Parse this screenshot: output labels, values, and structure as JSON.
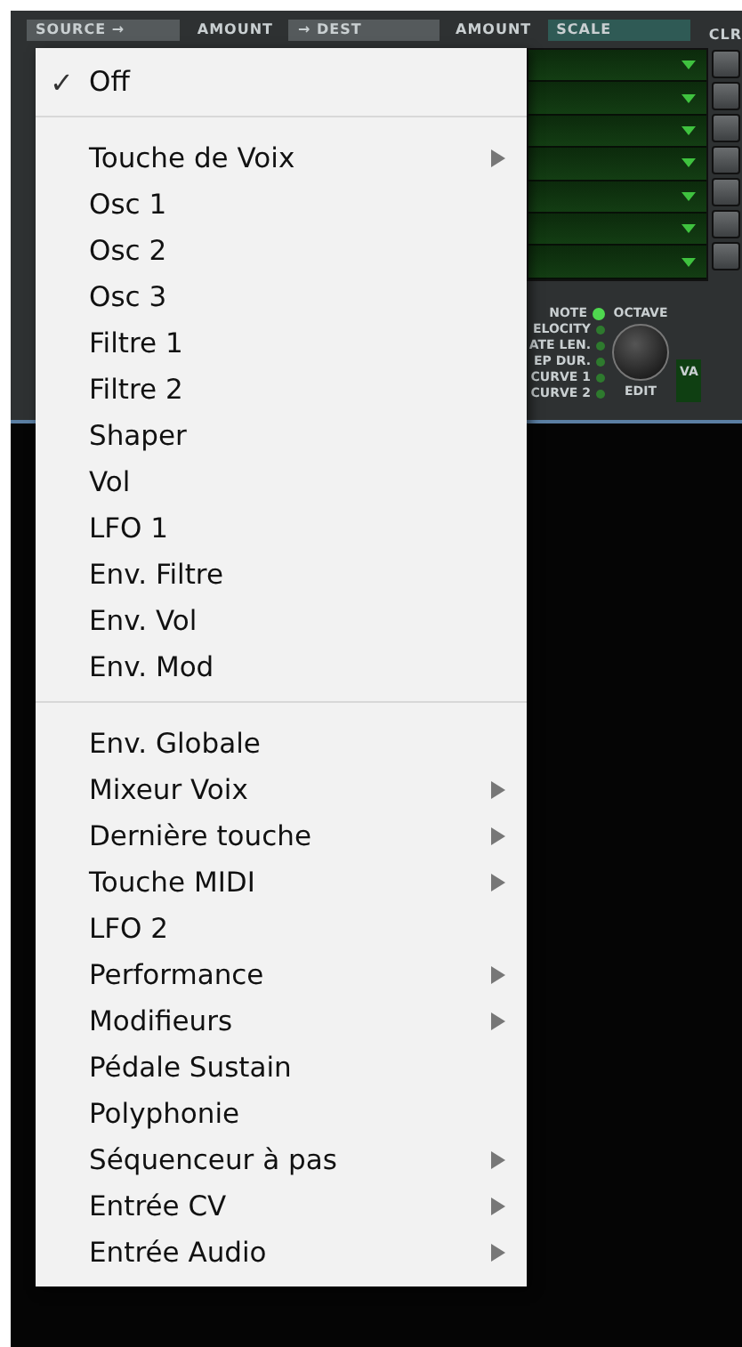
{
  "header": {
    "source": "SOURCE →",
    "amount": "AMOUNT",
    "dest": "→ DEST",
    "amount_2": "AMOUNT",
    "scale": "SCALE",
    "clear": "CLR"
  },
  "scale_rows": [
    {
      "kind": "slot"
    },
    {
      "kind": "slot"
    },
    {
      "kind": "slot"
    },
    {
      "kind": "slot"
    },
    {
      "kind": "slot"
    },
    {
      "kind": "slot"
    },
    {
      "kind": "slot"
    }
  ],
  "sequencer": {
    "sources": [
      {
        "label": "NOTE",
        "on": true
      },
      {
        "label": "ELOCITY",
        "on": false
      },
      {
        "label": "ATE LEN.",
        "on": false
      },
      {
        "label": "EP DUR.",
        "on": false
      },
      {
        "label": "CURVE 1",
        "on": false
      },
      {
        "label": "CURVE 2",
        "on": false
      }
    ],
    "octave": "OCTAVE",
    "edit": "EDIT",
    "value": "VA"
  },
  "menu": {
    "check_glyph": "✓",
    "groups": [
      [
        {
          "label": "Off",
          "checked": true,
          "submenu": false
        }
      ],
      [
        {
          "label": "Touche de Voix",
          "checked": false,
          "submenu": true
        },
        {
          "label": "Osc 1",
          "checked": false,
          "submenu": false
        },
        {
          "label": "Osc 2",
          "checked": false,
          "submenu": false
        },
        {
          "label": "Osc 3",
          "checked": false,
          "submenu": false
        },
        {
          "label": "Filtre 1",
          "checked": false,
          "submenu": false
        },
        {
          "label": "Filtre 2",
          "checked": false,
          "submenu": false
        },
        {
          "label": "Shaper",
          "checked": false,
          "submenu": false
        },
        {
          "label": "Vol",
          "checked": false,
          "submenu": false
        },
        {
          "label": "LFO 1",
          "checked": false,
          "submenu": false
        },
        {
          "label": "Env. Filtre",
          "checked": false,
          "submenu": false
        },
        {
          "label": "Env. Vol",
          "checked": false,
          "submenu": false
        },
        {
          "label": "Env. Mod",
          "checked": false,
          "submenu": false
        }
      ],
      [
        {
          "label": "Env. Globale",
          "checked": false,
          "submenu": false
        },
        {
          "label": "Mixeur Voix",
          "checked": false,
          "submenu": true
        },
        {
          "label": "Dernière touche",
          "checked": false,
          "submenu": true
        },
        {
          "label": "Touche MIDI",
          "checked": false,
          "submenu": true
        },
        {
          "label": "LFO 2",
          "checked": false,
          "submenu": false
        },
        {
          "label": "Performance",
          "checked": false,
          "submenu": true
        },
        {
          "label": "Modifieurs",
          "checked": false,
          "submenu": true
        },
        {
          "label": "Pédale Sustain",
          "checked": false,
          "submenu": false
        },
        {
          "label": "Polyphonie",
          "checked": false,
          "submenu": false
        },
        {
          "label": "Séquenceur à pas",
          "checked": false,
          "submenu": true
        },
        {
          "label": "Entrée CV",
          "checked": false,
          "submenu": true
        },
        {
          "label": "Entrée Audio",
          "checked": false,
          "submenu": true
        }
      ]
    ]
  }
}
